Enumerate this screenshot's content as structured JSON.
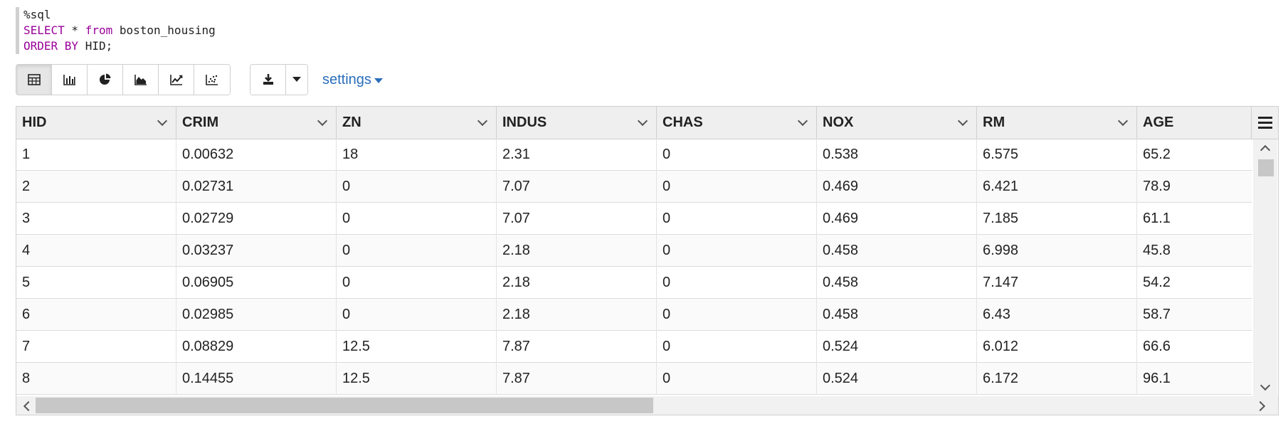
{
  "editor": {
    "lines": [
      [
        {
          "t": "%sql",
          "c": "tk-magic"
        }
      ],
      [
        {
          "t": "SELECT",
          "c": "tk-kw"
        },
        {
          "t": " * ",
          "c": "tk-plain"
        },
        {
          "t": "from",
          "c": "tk-kw"
        },
        {
          "t": " boston_housing",
          "c": "tk-plain"
        }
      ],
      [
        {
          "t": "ORDER BY",
          "c": "tk-kw"
        },
        {
          "t": " HID;",
          "c": "tk-plain"
        }
      ]
    ]
  },
  "toolbar": {
    "views": [
      {
        "name": "table-view-button",
        "icon": "table-icon",
        "active": true
      },
      {
        "name": "bar-chart-button",
        "icon": "bar-chart-icon",
        "active": false
      },
      {
        "name": "pie-chart-button",
        "icon": "pie-chart-icon",
        "active": false
      },
      {
        "name": "area-chart-button",
        "icon": "area-chart-icon",
        "active": false
      },
      {
        "name": "line-chart-button",
        "icon": "line-chart-icon",
        "active": false
      },
      {
        "name": "scatter-chart-button",
        "icon": "scatter-chart-icon",
        "active": false
      }
    ],
    "download_icon": "download-icon",
    "settings_label": "settings"
  },
  "grid": {
    "columns": [
      "HID",
      "CRIM",
      "ZN",
      "INDUS",
      "CHAS",
      "NOX",
      "RM",
      "AGE"
    ],
    "rows": [
      [
        "1",
        "0.00632",
        "18",
        "2.31",
        "0",
        "0.538",
        "6.575",
        "65.2"
      ],
      [
        "2",
        "0.02731",
        "0",
        "7.07",
        "0",
        "0.469",
        "6.421",
        "78.9"
      ],
      [
        "3",
        "0.02729",
        "0",
        "7.07",
        "0",
        "0.469",
        "7.185",
        "61.1"
      ],
      [
        "4",
        "0.03237",
        "0",
        "2.18",
        "0",
        "0.458",
        "6.998",
        "45.8"
      ],
      [
        "5",
        "0.06905",
        "0",
        "2.18",
        "0",
        "0.458",
        "7.147",
        "54.2"
      ],
      [
        "6",
        "0.02985",
        "0",
        "2.18",
        "0",
        "0.458",
        "6.43",
        "58.7"
      ],
      [
        "7",
        "0.08829",
        "12.5",
        "7.87",
        "0",
        "0.524",
        "6.012",
        "66.6"
      ],
      [
        "8",
        "0.14455",
        "12.5",
        "7.87",
        "0",
        "0.524",
        "6.172",
        "96.1"
      ]
    ]
  }
}
